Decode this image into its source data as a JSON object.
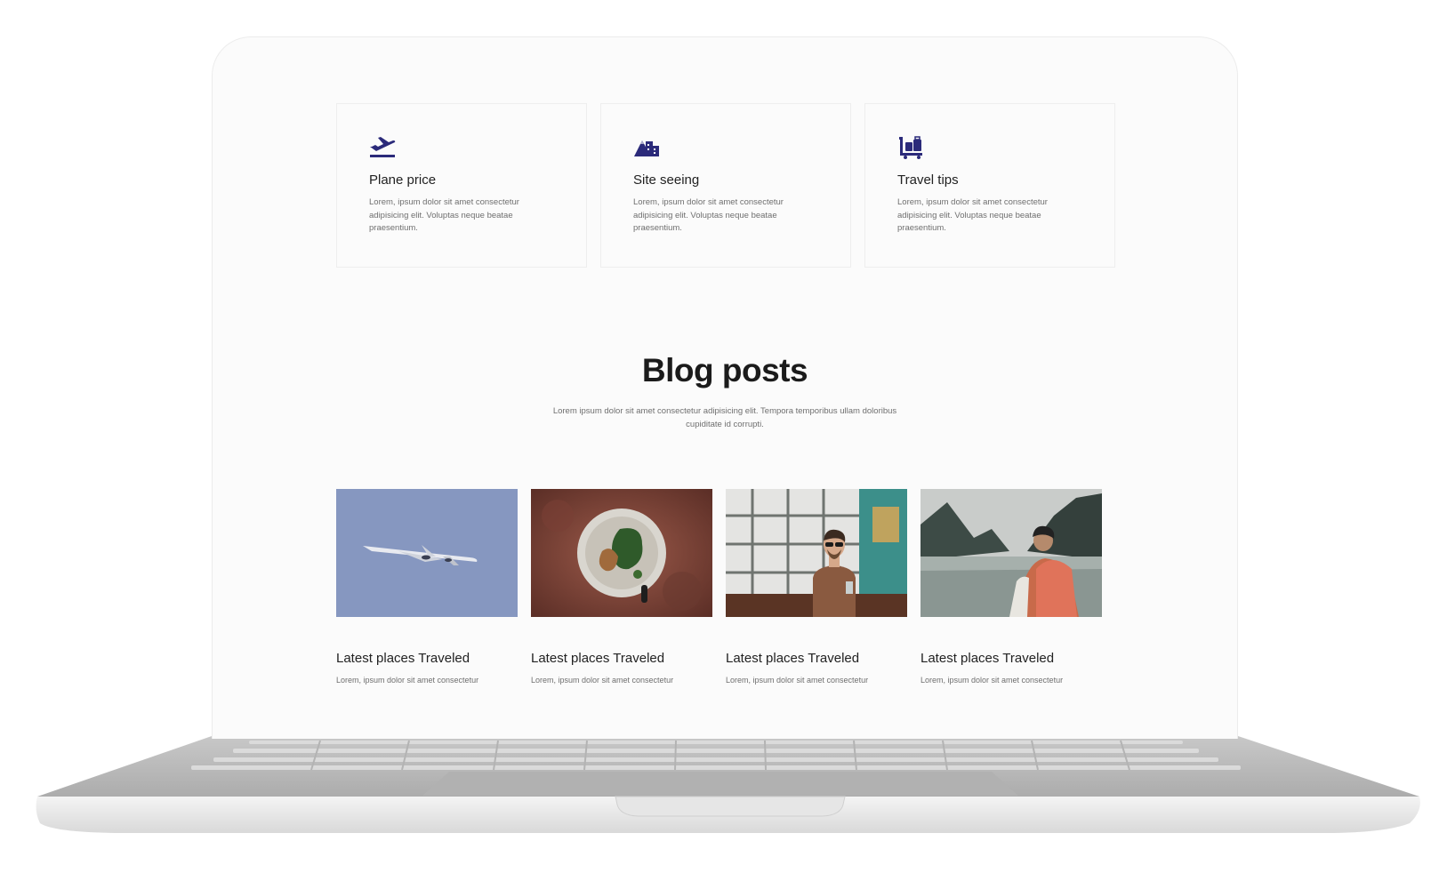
{
  "features": [
    {
      "icon": "plane-departure-icon",
      "title": "Plane price",
      "description": "Lorem, ipsum dolor sit amet consectetur adipisicing elit. Voluptas neque beatae praesentium."
    },
    {
      "icon": "mountain-city-icon",
      "title": "Site seeing",
      "description": "Lorem, ipsum dolor sit amet consectetur adipisicing elit. Voluptas neque beatae praesentium."
    },
    {
      "icon": "luggage-cart-icon",
      "title": "Travel tips",
      "description": "Lorem, ipsum dolor sit amet consectetur adipisicing elit. Voluptas neque beatae praesentium."
    }
  ],
  "blog": {
    "title": "Blog posts",
    "subtitle": "Lorem ipsum dolor sit amet consectetur adipisicing elit. Tempora temporibus ullam doloribus cupiditate id corrupti."
  },
  "posts": [
    {
      "image": "airplane-photo",
      "title": "Latest places Traveled",
      "description": "Lorem, ipsum dolor sit amet consectetur"
    },
    {
      "image": "food-bowl-photo",
      "title": "Latest places Traveled",
      "description": "Lorem, ipsum dolor sit amet consectetur"
    },
    {
      "image": "man-in-cafe-photo",
      "title": "Latest places Traveled",
      "description": "Lorem, ipsum dolor sit amet consectetur"
    },
    {
      "image": "lake-hiker-photo",
      "title": "Latest places Traveled",
      "description": "Lorem, ipsum dolor sit amet consectetur"
    }
  ],
  "colors": {
    "accent": "#2b2a7a",
    "heading": "#1b1b1b",
    "text": "#6f6f6f",
    "laptop_body": "#b8b8b8"
  }
}
